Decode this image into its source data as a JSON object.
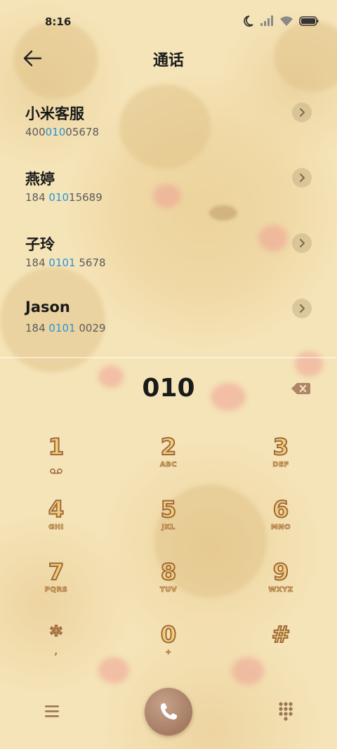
{
  "status": {
    "time": "8:16"
  },
  "header": {
    "title": "通话"
  },
  "contacts": [
    {
      "name": "小米客服",
      "number_pre": "400",
      "number_hl": "010",
      "number_post": "05678"
    },
    {
      "name": "燕婷",
      "number_pre": "184 ",
      "number_hl": "010",
      "number_post": "15689"
    },
    {
      "name": "子玲",
      "number_pre": "184 ",
      "number_hl": "0101",
      "number_post": " 5678"
    },
    {
      "name": "Jason",
      "number_pre": "184 ",
      "number_hl": "0101",
      "number_post": " 0029"
    }
  ],
  "dialer": {
    "entry": "010"
  },
  "keypad": [
    {
      "digit": "1",
      "sub": ""
    },
    {
      "digit": "2",
      "sub": "ABC"
    },
    {
      "digit": "3",
      "sub": "DEF"
    },
    {
      "digit": "4",
      "sub": "GHI"
    },
    {
      "digit": "5",
      "sub": "JKL"
    },
    {
      "digit": "6",
      "sub": "MNO"
    },
    {
      "digit": "7",
      "sub": "PQRS"
    },
    {
      "digit": "8",
      "sub": "TUV"
    },
    {
      "digit": "9",
      "sub": "WXYZ"
    },
    {
      "digit": "*",
      "sub": ","
    },
    {
      "digit": "0",
      "sub": "+"
    },
    {
      "digit": "#",
      "sub": ""
    }
  ],
  "icons": {
    "back": "arrow-left-icon",
    "chevron": "chevron-right-icon",
    "backspace": "backspace-icon",
    "voicemail": "voicemail-icon",
    "menu": "menu-icon",
    "call": "phone-icon",
    "dialpad": "dialpad-icon"
  },
  "colors": {
    "highlight": "#2a94d8",
    "call_button": "#a57c63",
    "key_fill": "#f6cd77",
    "key_outline": "#9c6a3f"
  }
}
